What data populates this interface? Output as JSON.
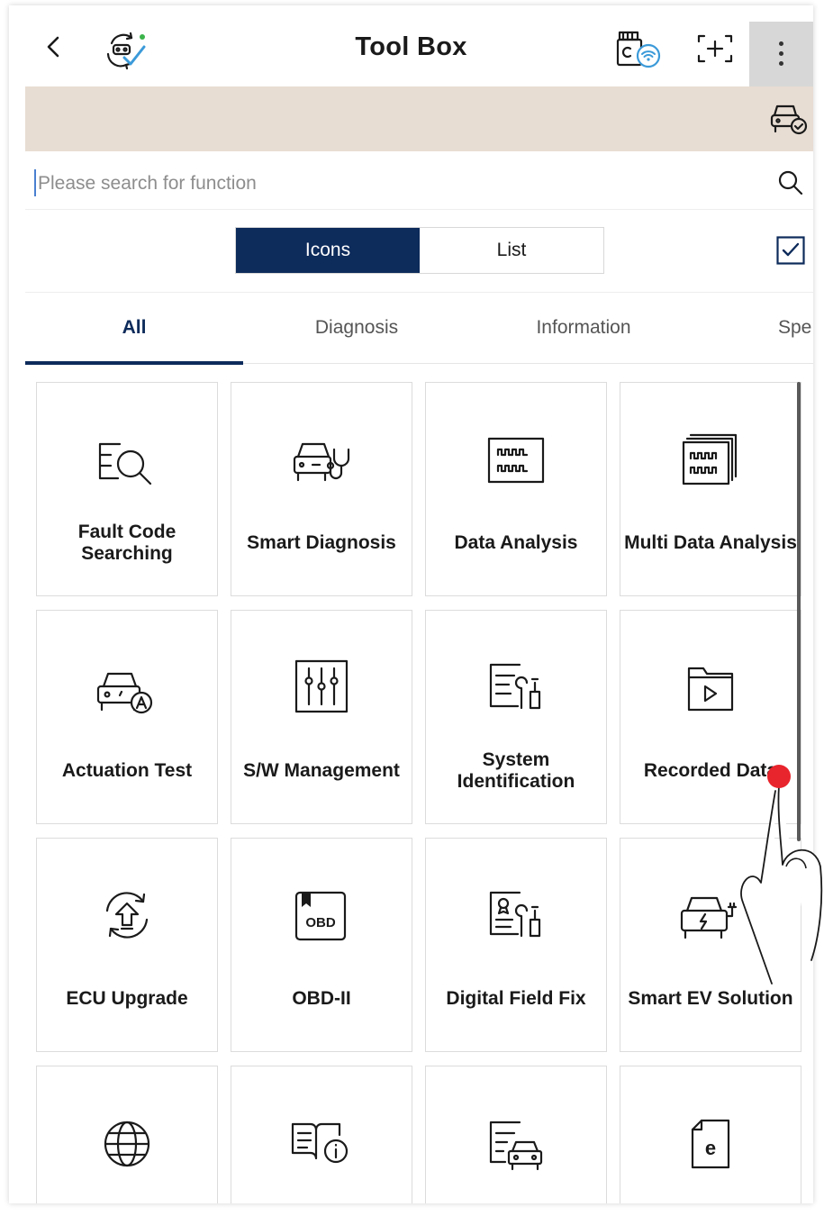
{
  "header": {
    "title": "Tool Box",
    "back_icon": "chevron-left-icon",
    "app_icon": "gear-car-check-icon",
    "vci_icon": "vci-wifi-icon",
    "scan_icon": "screen-capture-icon",
    "more_icon": "more-vertical-icon"
  },
  "banner": {
    "icon": "vehicle-check-icon",
    "color": "#e8ddd3"
  },
  "search": {
    "placeholder": "Please search for function",
    "value": ""
  },
  "view_toggle": {
    "icons_label": "Icons",
    "list_label": "List",
    "selected": "Icons"
  },
  "tabs": [
    {
      "label": "All",
      "active": true
    },
    {
      "label": "Diagnosis",
      "active": false
    },
    {
      "label": "Information",
      "active": false
    },
    {
      "label": "Spe",
      "active": false
    }
  ],
  "cards": [
    {
      "label": "Fault Code Searching",
      "icon": "fault-code-search-icon"
    },
    {
      "label": "Smart Diagnosis",
      "icon": "car-stethoscope-icon"
    },
    {
      "label": "Data Analysis",
      "icon": "waveform-icon"
    },
    {
      "label": "Multi Data Analysis",
      "icon": "multi-waveform-icon"
    },
    {
      "label": "Actuation Test",
      "icon": "car-actuation-icon"
    },
    {
      "label": "S/W Management",
      "icon": "sliders-icon"
    },
    {
      "label": "System Identification",
      "icon": "document-tools-icon"
    },
    {
      "label": "Recorded Data",
      "icon": "folder-play-icon"
    },
    {
      "label": "ECU Upgrade",
      "icon": "upgrade-cycle-icon"
    },
    {
      "label": "OBD-II",
      "icon": "obd-book-icon",
      "icon_text": "OBD"
    },
    {
      "label": "Digital Field Fix",
      "icon": "certificate-tools-icon"
    },
    {
      "label": "Smart EV Solution",
      "icon": "ev-car-icon"
    },
    {
      "label": "",
      "icon": "globe-icon"
    },
    {
      "label": "",
      "icon": "book-info-icon"
    },
    {
      "label": "",
      "icon": "document-car-icon"
    },
    {
      "label": "",
      "icon": "e-document-icon",
      "icon_text": "e"
    }
  ],
  "colors": {
    "accent": "#0d2b5b",
    "touch_dot": "#e8242c"
  }
}
